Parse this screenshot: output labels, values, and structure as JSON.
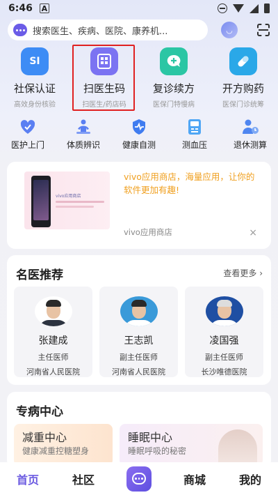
{
  "status": {
    "time": "6:46",
    "indicator": "A"
  },
  "search": {
    "placeholder": "搜索医生、疾病、医院、康养机..."
  },
  "main_services": [
    {
      "label": "社保认证",
      "sub": "高效身份核验",
      "icon": "social-security-icon",
      "color": "#3d8cf5",
      "glyph": "SI"
    },
    {
      "label": "扫医生码",
      "sub": "扫医生/药店码",
      "icon": "qr-scan-icon",
      "color": "#7b73f2",
      "glyph": "▦"
    },
    {
      "label": "复诊续方",
      "sub": "医保门特慢病",
      "icon": "chat-plus-icon",
      "color": "#2bc6a4",
      "glyph": "+"
    },
    {
      "label": "开方购药",
      "sub": "医保门诊统筹",
      "icon": "pill-icon",
      "color": "#2aa8e8",
      "glyph": "💊"
    }
  ],
  "sub_services": [
    {
      "label": "医护上门",
      "icon": "heart-home-icon"
    },
    {
      "label": "体质辨识",
      "icon": "meditation-icon"
    },
    {
      "label": "健康自测",
      "icon": "shield-pulse-icon"
    },
    {
      "label": "测血压",
      "icon": "blood-pressure-icon"
    },
    {
      "label": "退休测算",
      "icon": "retirement-calc-icon"
    }
  ],
  "ad": {
    "title": "vivo应用商店，海量应用，让你的软件更加有趣!",
    "source": "vivo应用商店",
    "thumb_title": "vivo应用商店",
    "close": "×"
  },
  "doctors_section": {
    "title": "名医推荐",
    "see_more": "查看更多 ›",
    "doctors": [
      {
        "name": "张建成",
        "title": "主任医师",
        "hospital": "河南省人民医院",
        "photo_bg": "#ffffff",
        "coat": "#2c3340"
      },
      {
        "name": "王志凯",
        "title": "副主任医师",
        "hospital": "河南省人民医院",
        "photo_bg": "#3a9ad9",
        "coat": "#ffffff"
      },
      {
        "name": "凌国强",
        "title": "副主任医师",
        "hospital": "长沙唯德医院",
        "photo_bg": "#1f4fa3",
        "coat": "#ffffff"
      }
    ]
  },
  "special_section": {
    "title": "专病中心",
    "tiles": [
      {
        "title": "减重中心",
        "sub": "健康减重控糖塑身"
      },
      {
        "title": "睡眠中心",
        "sub": "睡眠呼吸的秘密"
      }
    ]
  },
  "bottom_nav": {
    "home": "首页",
    "community": "社区",
    "mall": "商城",
    "mine": "我的"
  },
  "colors": {
    "accent": "#6a59e0",
    "highlight": "#e02020",
    "ad_text": "#f0a020"
  }
}
